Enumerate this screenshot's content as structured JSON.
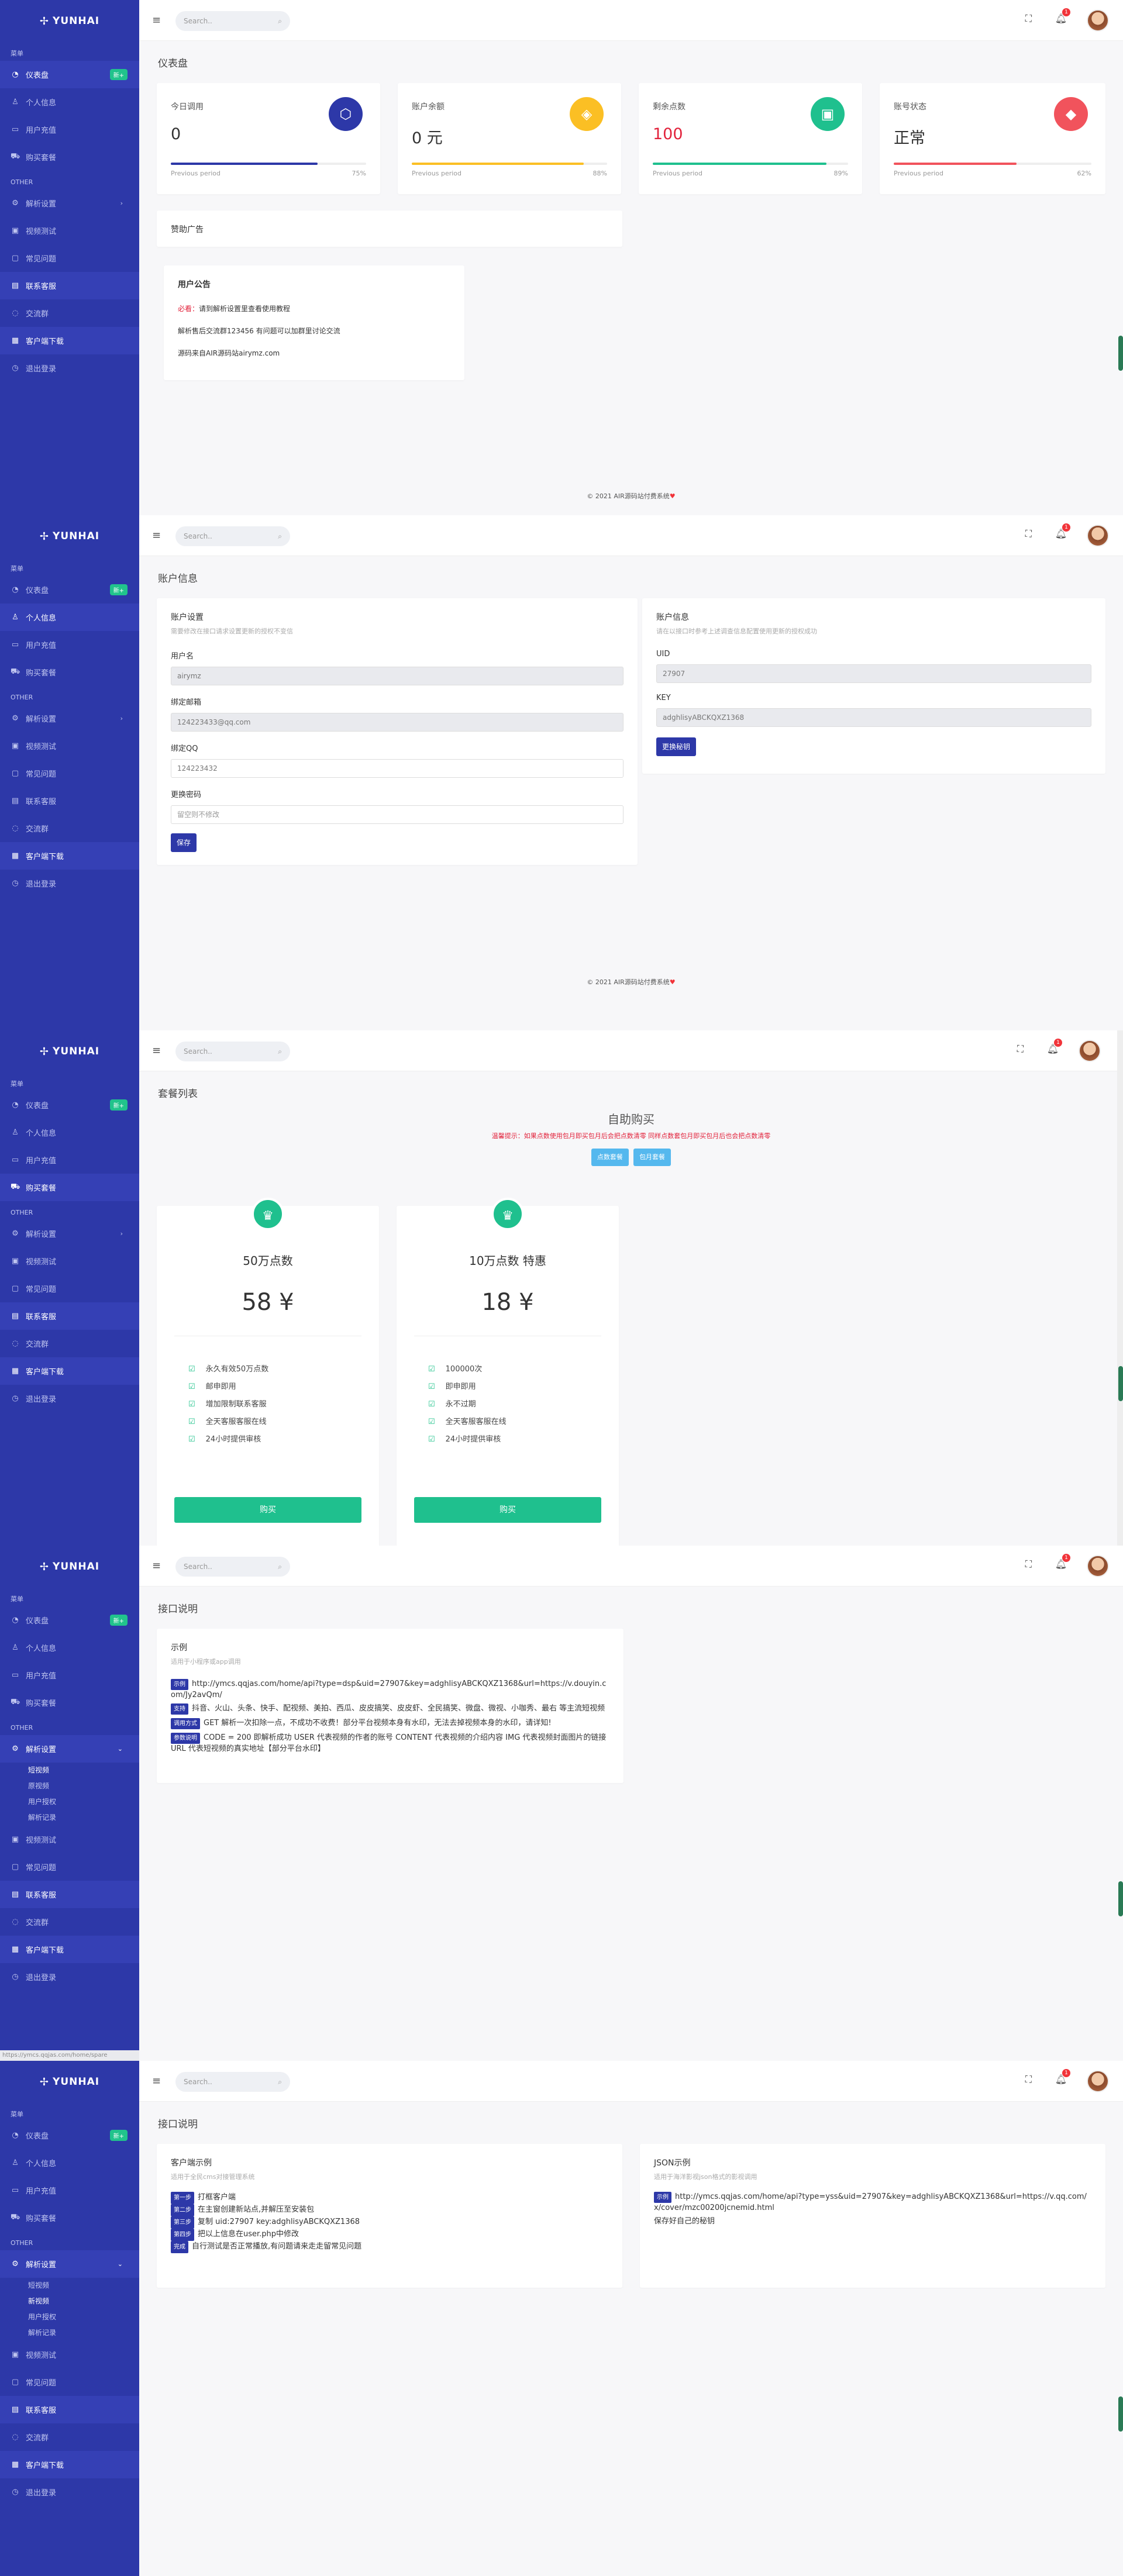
{
  "brand": "YUNHAI",
  "search_placeholder": "Search..",
  "notif_count": "1",
  "nav": {
    "main_section": "菜单",
    "other_section": "OTHER",
    "dashboard": "仪表盘",
    "dashboard_badge": "新+",
    "profile": "个人信息",
    "logs": "用户充值",
    "buy": "购买套餐",
    "parse_settings": "解析设置",
    "video_test": "视频测试",
    "faq": "常见问题",
    "contact": "联系客服",
    "join_group": "交流群",
    "client_download": "客户端下载",
    "logout": "退出登录",
    "sub_items": [
      "短视频",
      "原视频",
      "用户授权",
      "解析记录"
    ],
    "sub_items_alt": [
      "短视频",
      "新视频",
      "用户授权",
      "解析记录"
    ]
  },
  "footer": "© 2021 AIR源码站付费系统",
  "s1": {
    "title": "仪表盘",
    "stats": [
      {
        "label": "今日调用",
        "value": "0",
        "pp": "Previous period",
        "pct": "75%",
        "color": "#2d38a8",
        "fill": 0.75,
        "icon": "cube-icon"
      },
      {
        "label": "账户余额",
        "value": "0 元",
        "pp": "Previous period",
        "pct": "88%",
        "color": "#fbbf24",
        "fill": 0.88,
        "icon": "tags-icon"
      },
      {
        "label": "剩余点数",
        "value": "100",
        "pp": "Previous period",
        "pct": "89%",
        "color": "#1fc08e",
        "fill": 0.89,
        "icon": "briefcase-icon"
      },
      {
        "label": "账号状态",
        "value": "正常",
        "pp": "Previous period",
        "pct": "62%",
        "color": "#f1535c",
        "fill": 0.62,
        "icon": "layers-icon"
      }
    ],
    "ad_title": "赞助广告",
    "notice_title": "用户公告",
    "notice_warn": "必看：",
    "notice_line1": "请到解析设置里查看使用教程",
    "notice_line2": "解析售后交流群123456 有问题可以加群里讨论交流",
    "notice_line3": "源码来自AIR源码站airymz.com"
  },
  "s2": {
    "title": "账户信息",
    "left_title": "账户设置",
    "left_sub": "需要修改在接口请求设置更新的授权不变信",
    "username_label": "用户名",
    "username": "airymz",
    "email_label": "绑定邮箱",
    "email": "124223433@qq.com",
    "qq_label": "绑定QQ",
    "qq": "124223432",
    "pw_label": "更换密码",
    "pw_placeholder": "留空则不修改",
    "save": "保存",
    "right_title": "账户信息",
    "right_sub": "请在以接口时参考上述调查信息配置使用更新的授权成功",
    "uid_label": "UID",
    "uid": "27907",
    "key_label": "KEY",
    "key": "adghlisyABCKQXZ1368",
    "reset": "更换秘钥"
  },
  "s3": {
    "title": "套餐列表",
    "heading": "自助购买",
    "notice": "温馨提示：如果点数使用包月即买包月后会把点数清零 同样点数套包月即买包月后也会把点数清零",
    "tab1": "点数套餐",
    "tab2": "包月套餐",
    "packages": [
      {
        "name": "50万点数",
        "price": "58 ¥",
        "features": [
          "永久有效50万点数",
          "邮申即用",
          "增加限制联系客服",
          "全天客服客服在线",
          "24小时提供审核"
        ],
        "buy": "购买"
      },
      {
        "name": "10万点数 特惠",
        "price": "18 ¥",
        "features": [
          "100000次",
          "即申即用",
          "永不过期",
          "全天客服客服在线",
          "24小时提供审核"
        ],
        "buy": "购买"
      }
    ]
  },
  "s4": {
    "title": "接口说明",
    "card_title": "示例",
    "card_sub": "适用于小程序或app调用",
    "l1_tag": "示例",
    "l1": "http://ymcs.qqjas.com/home/api?type=dsp&uid=27907&key=adghlisyABCKQXZ1368&url=https://v.douyin.com/Jy2avQm/",
    "l2_tag": "支持",
    "l2": "抖音、火山、头条、快手、配视频、美拍、西瓜、皮皮搞笑、皮皮虾、全民搞笑、微盘、微视、小咖秀、最右 等主流短视频",
    "l3_tag": "调用方式",
    "l3": "GET 解析一次扣除一点，不成功不收费！部分平台视频本身有水印，无法去掉视频本身的水印，请详知!",
    "l4_tag": "参数说明",
    "l4": "CODE = 200 即解析成功 USER 代表视频的作者的账号 CONTENT 代表视频的介绍内容 IMG 代表视频封面图片的链接 URL 代表短视频的真实地址【部分平台水印】"
  },
  "s5": {
    "title": "接口说明",
    "left_title": "客户端示例",
    "left_sub": "适用于全民cms对接管理系统",
    "steps": [
      {
        "tag": "第一步",
        "text": "打框客户端"
      },
      {
        "tag": "第二步",
        "text": "在主窗创建新站点,并解压至安装包"
      },
      {
        "tag": "第三步",
        "text": "复制 uid:27907 key:adghlisyABCKQXZ1368"
      },
      {
        "tag": "第四步",
        "text": "把以上信息在user.php中修改"
      },
      {
        "tag": "完成",
        "text": "自行测试是否正常播放,有问题请来走走留常见问题"
      }
    ],
    "right_title": "JSON示例",
    "right_sub": "适用于海洋影视json格式的影视调用",
    "r1_tag": "示例",
    "r1": "http://ymcs.qqjas.com/home/api?type=yss&uid=27907&key=adghlisyABCKQXZ1368&url=https://v.qq.com/x/cover/mzc00200jcnemid.html",
    "r2": "保存好自己的秘钥"
  },
  "status_url": "https://ymcs.qqjas.com/home/spare"
}
